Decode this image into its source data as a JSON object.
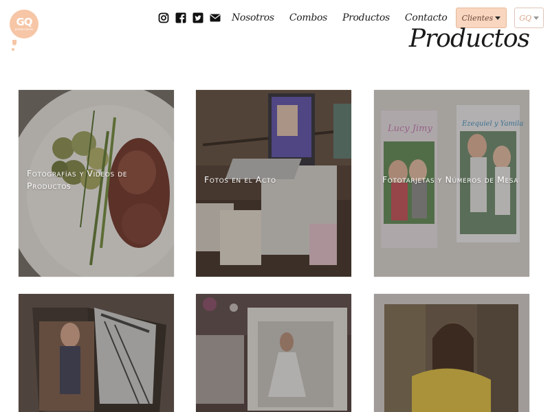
{
  "logo": {
    "mark": "GQ",
    "tagline": "producciones"
  },
  "nav": {
    "social": [
      "instagram-icon",
      "facebook-icon",
      "twitter-icon",
      "envelope-icon"
    ],
    "links": [
      "Nosotros",
      "Combos",
      "Productos",
      "Contacto"
    ],
    "clientes_label": "Clientes",
    "gq_label": "GQ"
  },
  "page": {
    "title": "Productos"
  },
  "products": [
    {
      "caption": "Fotografías y Videos de Productos"
    },
    {
      "caption": "Fotos en el Acto"
    },
    {
      "caption": "Fototarjetas y Números de Mesa"
    },
    {
      "caption": ""
    },
    {
      "caption": ""
    },
    {
      "caption": ""
    }
  ],
  "colors": {
    "accent": "#f8d6c0",
    "logo": "#f6c6a6"
  }
}
